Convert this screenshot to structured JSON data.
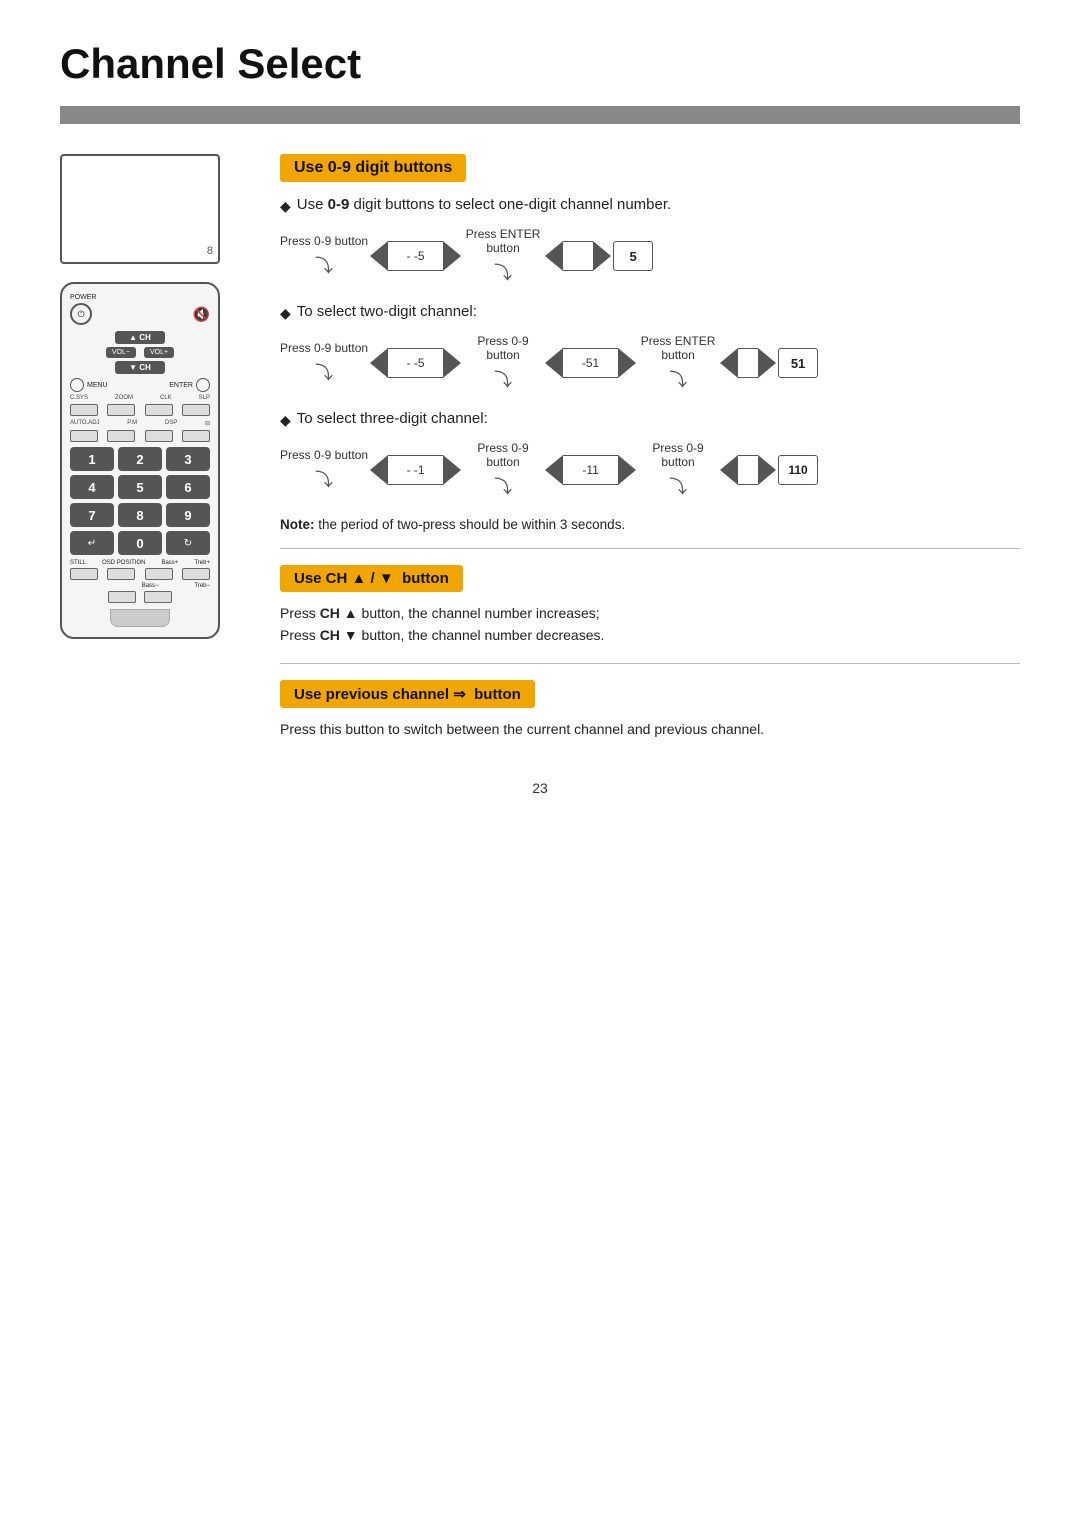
{
  "page": {
    "title": "Channel Select",
    "page_number": "23"
  },
  "sections": {
    "use09": {
      "header": "Use 0-9 digit buttons",
      "bullet1": {
        "prefix": "Use ",
        "bold": "0-9",
        "suffix": " digit buttons to select one-digit channel number."
      },
      "diagram1": {
        "step1_label": "Press 0-9 button",
        "arrow1_val": "- -5",
        "step2_label": "Press ENTER\nbutton",
        "arrow2_val": "",
        "result": "5"
      },
      "bullet2": "To select two-digit channel:",
      "diagram2": {
        "step1_label": "Press 0-9 button",
        "arrow1_val": "- -5",
        "step2_label": "Press 0-9\nbutton",
        "arrow2_val": "-51",
        "step3_label": "Press ENTER\nbutton",
        "arrow3_val": "",
        "result": "51"
      },
      "bullet3": "To select three-digit channel:",
      "diagram3": {
        "step1_label": "Press 0-9 button",
        "arrow1_val": "- -1",
        "step2_label": "Press 0-9\nbutton",
        "arrow2_val": "-11",
        "step3_label": "Press 0-9\nbutton",
        "arrow3_val": "",
        "result": "110"
      },
      "note": "Note: the period of two-press should be within 3 seconds."
    },
    "useCH": {
      "header": "Use CH ▲ / ▼  button",
      "desc1": "Press CH ▲ button, the channel number increases;",
      "desc2": "Press CH ▼ button,  the channel number decreases."
    },
    "usePrev": {
      "header": "Use previous channel ⇒  button",
      "desc": "Press this button to switch between the current channel and previous channel."
    }
  },
  "remote": {
    "screen_number": "8",
    "labels": {
      "power": "POWER",
      "ch": "CH",
      "vol_minus": "VOL\n−",
      "vol_plus": "VOL\n+",
      "menu": "MENU",
      "enter": "ENTER",
      "csys": "C.SYS",
      "zoom": "ZOOM",
      "clk": "CLK",
      "slp": "SLP",
      "auto_adj": "AUTO.ADJ",
      "pm": "P.M",
      "dsp": "DSP",
      "still": "STILL",
      "osd_position": "OSD\nPOSITION",
      "bass_plus": "Bass+",
      "treb_plus": "Treb+",
      "bass_minus": "Bass−",
      "treb_minus": "Treb−"
    },
    "numpad": [
      "1",
      "2",
      "3",
      "4",
      "5",
      "6",
      "7",
      "8",
      "9",
      "↵",
      "0",
      "↻"
    ]
  }
}
